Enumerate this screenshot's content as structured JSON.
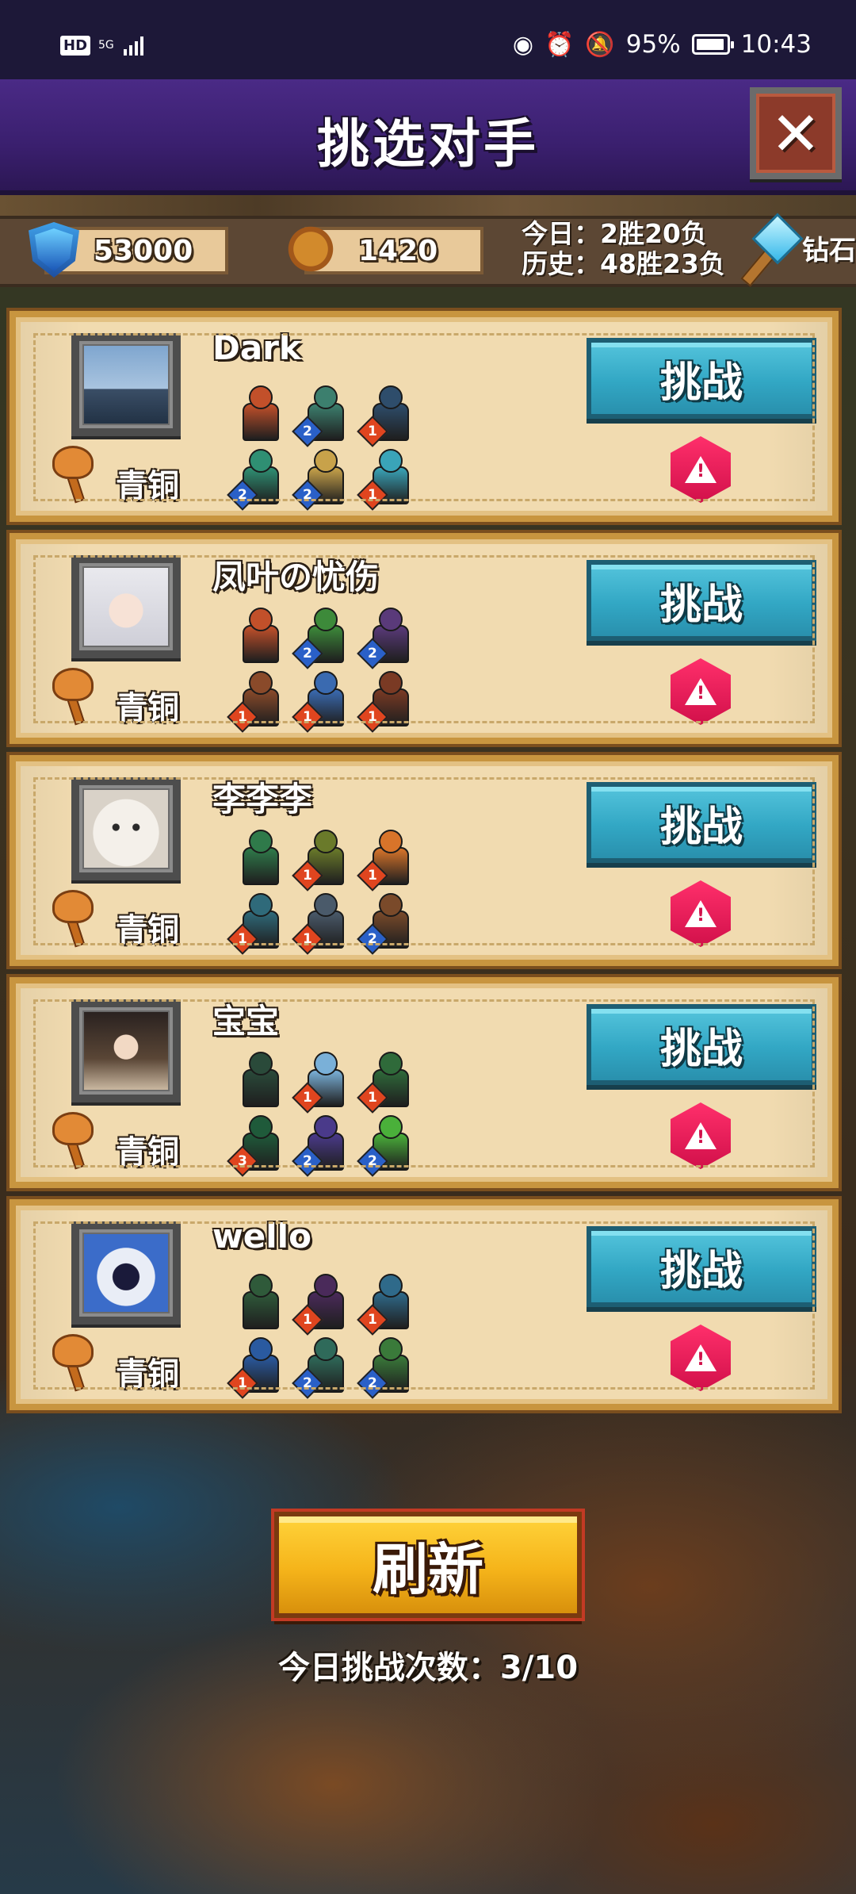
{
  "status_bar": {
    "hd": "HD",
    "network": "5G",
    "battery_percent": "95%",
    "battery_level": 0.95,
    "time": "10:43",
    "icons": [
      "eye-icon",
      "alarm-icon",
      "mute-icon",
      "battery-icon"
    ]
  },
  "title": "挑选对手",
  "close_icon": "✕",
  "resources": {
    "trophies": "53000",
    "medals": "1420",
    "today_record": "今日：2胜20负",
    "history_record": "历史：48胜23负",
    "diamond_label": "钻石"
  },
  "challenge_label": "挑战",
  "opponents": [
    {
      "name": "Dark",
      "rank": "青铜",
      "avatar": "silhouette-photo",
      "team": [
        {
          "level": "",
          "color": "#c2502a"
        },
        {
          "level": "2",
          "color": "#3c7f6e"
        },
        {
          "level": "1",
          "color": "#2e4d6b"
        },
        {
          "level": "2",
          "color": "#2f8f73"
        },
        {
          "level": "2",
          "color": "#c8a24a"
        },
        {
          "level": "1",
          "color": "#3aa4b8"
        }
      ]
    },
    {
      "name": "凤叶の忧伤",
      "rank": "青铜",
      "avatar": "anime-girl-white-hair",
      "team": [
        {
          "level": "",
          "color": "#c2502a"
        },
        {
          "level": "2",
          "color": "#3d8a3a"
        },
        {
          "level": "2",
          "color": "#5a3a7a"
        },
        {
          "level": "1",
          "color": "#8a4a2a"
        },
        {
          "level": "1",
          "color": "#3a6ab0"
        },
        {
          "level": "1",
          "color": "#7a3a24"
        }
      ]
    },
    {
      "name": "李李李",
      "rank": "青铜",
      "avatar": "white-cat",
      "team": [
        {
          "level": "",
          "color": "#2f7a4a"
        },
        {
          "level": "1",
          "color": "#6a7a2a"
        },
        {
          "level": "1",
          "color": "#d8742a"
        },
        {
          "level": "1",
          "color": "#2f6a7a"
        },
        {
          "level": "1",
          "color": "#4a5a6a"
        },
        {
          "level": "2",
          "color": "#7a4a2a"
        }
      ]
    },
    {
      "name": "宝宝",
      "rank": "青铜",
      "avatar": "anime-girl-dark-hair",
      "team": [
        {
          "level": "",
          "color": "#2a4a3a"
        },
        {
          "level": "1",
          "color": "#7ab0d8"
        },
        {
          "level": "1",
          "color": "#2f6a3a"
        },
        {
          "level": "3",
          "color": "#1f5a3a"
        },
        {
          "level": "2",
          "color": "#4a3a8a"
        },
        {
          "level": "2",
          "color": "#4ab03a"
        }
      ]
    },
    {
      "name": "wello",
      "rank": "青铜",
      "avatar": "blue-robot",
      "team": [
        {
          "level": "",
          "color": "#2f5a3a"
        },
        {
          "level": "1",
          "color": "#4a2a5a"
        },
        {
          "level": "1",
          "color": "#2f6a8a"
        },
        {
          "level": "1",
          "color": "#2a5aa0"
        },
        {
          "level": "2",
          "color": "#2f6a5a"
        },
        {
          "level": "2",
          "color": "#3a7a3a"
        }
      ]
    }
  ],
  "refresh_label": "刷新",
  "daily_challenges": "今日挑战次数：3/10",
  "colors": {
    "level_1": "#e0451f",
    "level_2": "#2a60c8",
    "level_3": "#e0451f",
    "challenge_button": "#32a7c4",
    "report_button": "#e01e58",
    "refresh_button": "#f5b41a"
  }
}
